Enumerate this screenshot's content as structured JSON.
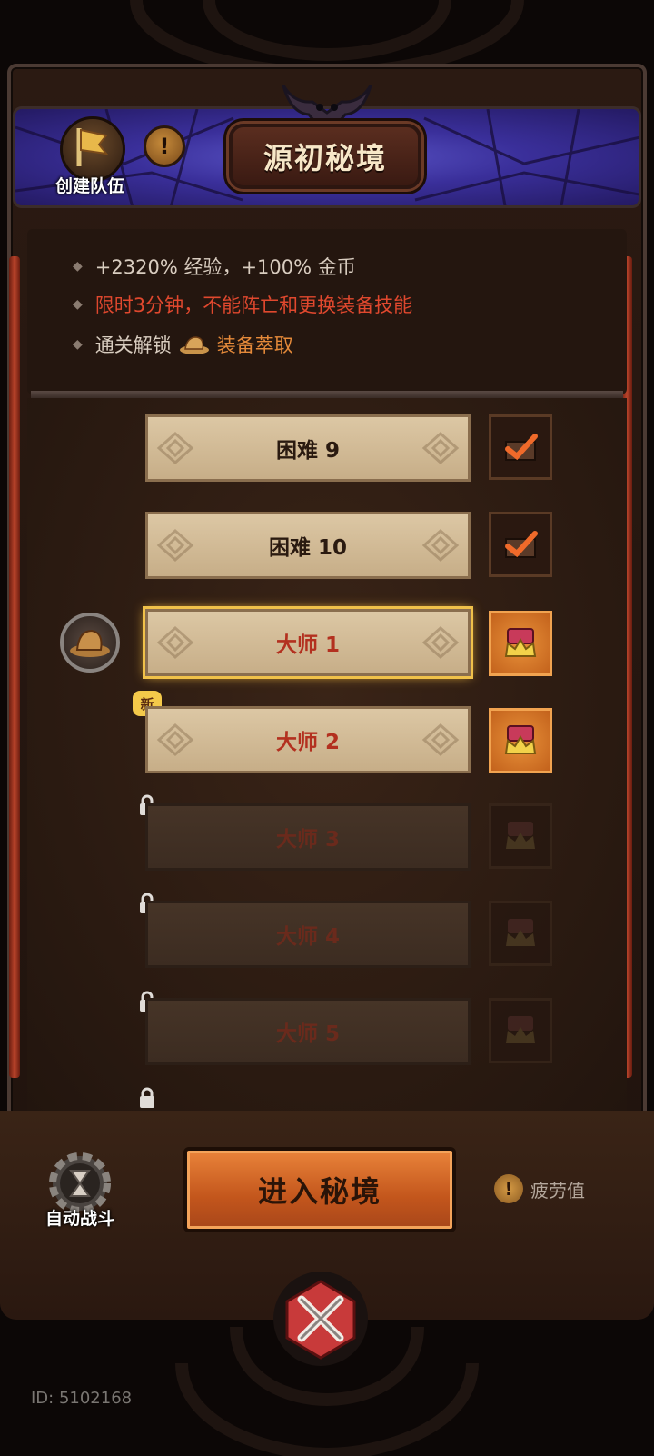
{
  "header": {
    "title": "源初秘境",
    "create_team_label": "创建队伍",
    "info_icon": "!"
  },
  "info": {
    "reward_line": "+2320% 经验，+100% 金币",
    "restriction_line": "限时3分钟，不能阵亡和更换装备技能",
    "unlock_prefix": "通关解锁",
    "unlock_item": "装备萃取",
    "bullet": "◆"
  },
  "levels": [
    {
      "label": "困难 9",
      "state": "done",
      "reward": "checked-chest-icon"
    },
    {
      "label": "困难 10",
      "state": "done",
      "reward": "checked-chest-icon"
    },
    {
      "label": "大师 1",
      "state": "selected",
      "reward": "crown-chest-icon"
    },
    {
      "label": "大师 2",
      "state": "new",
      "reward": "crown-chest-icon",
      "badge": "新"
    },
    {
      "label": "大师 3",
      "state": "locked",
      "reward": "crown-chest-icon"
    },
    {
      "label": "大师 4",
      "state": "locked",
      "reward": "crown-chest-icon"
    },
    {
      "label": "大师 5",
      "state": "locked",
      "reward": "crown-chest-icon"
    }
  ],
  "bottom": {
    "auto_battle_label": "自动战斗",
    "enter_label": "进入秘境",
    "fatigue_label": "疲劳值",
    "fatigue_icon": "!"
  },
  "footer": {
    "id_text": "ID: 5102168"
  },
  "colors": {
    "accent_orange": "#c3561c",
    "warning_red": "#e0482e",
    "header_blue": "#3a2f9a",
    "highlight_gold": "#f0c14a"
  }
}
